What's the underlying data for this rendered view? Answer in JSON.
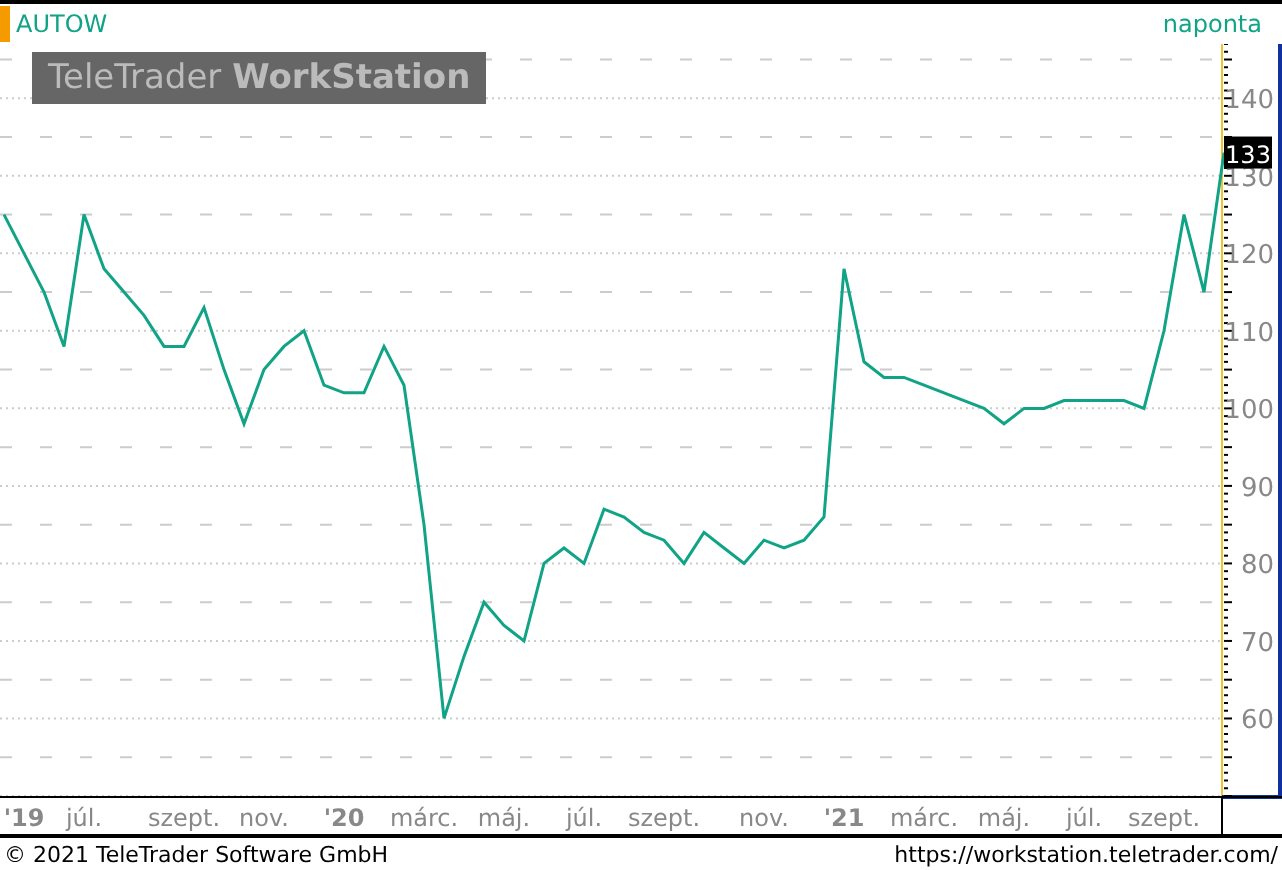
{
  "header": {
    "interval": "naponta",
    "watermark": "TeleTrader **WorkStation**"
  },
  "chart": {
    "last_price": "133",
    "chart_data": {
      "type": "line",
      "categories": [
        null,
        "'19",
        null,
        null,
        "júl.",
        null,
        null,
        null,
        null,
        "szept.",
        null,
        null,
        null,
        "nov.",
        null,
        null,
        null,
        "'20",
        null,
        null,
        null,
        "márc.",
        null,
        null,
        null,
        "máj.",
        null,
        null,
        null,
        "júl.",
        null,
        null,
        null,
        "szept.",
        null,
        null,
        null,
        null,
        "nov.",
        null,
        null,
        null,
        "'21",
        null,
        null,
        null,
        "márc.",
        null,
        null,
        null,
        "máj.",
        null,
        null,
        null,
        "júl.",
        null,
        null,
        null,
        "szept.",
        null,
        null,
        null
      ],
      "series": [
        {
          "name": "AUTOW",
          "color": "#10a386",
          "values": [
            125,
            120,
            115,
            108,
            125,
            118,
            115,
            112,
            108,
            108,
            113,
            105,
            98,
            105,
            108,
            110,
            103,
            102,
            102,
            108,
            103,
            85,
            60,
            68,
            75,
            72,
            70,
            80,
            82,
            80,
            87,
            86,
            84,
            83,
            80,
            84,
            82,
            80,
            83,
            82,
            83,
            86,
            118,
            106,
            104,
            104,
            103,
            102,
            101,
            100,
            98,
            100,
            100,
            101,
            101,
            101,
            101,
            100,
            110,
            125,
            115,
            133
          ]
        }
      ],
      "ylim": [
        50,
        147
      ],
      "grid": true,
      "yticks": [
        60,
        70,
        80,
        90,
        100,
        110,
        120,
        130,
        140
      ]
    }
  },
  "footer": {
    "copyright": "© 2021 TeleTrader Software GmbH",
    "url": "https://workstation.teletrader.com/"
  }
}
